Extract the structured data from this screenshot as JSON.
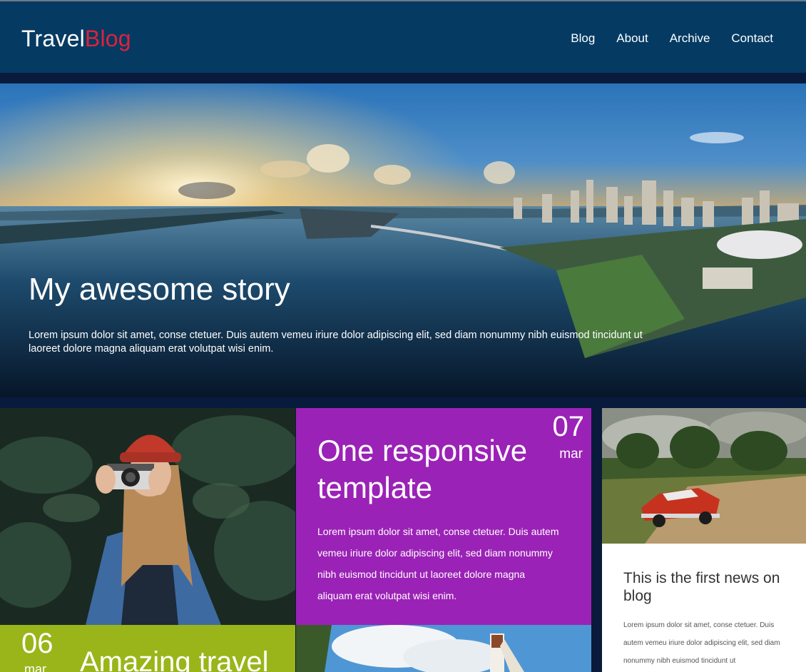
{
  "header": {
    "logo_part1": "Travel",
    "logo_part2": "Blog",
    "nav": [
      "Blog",
      "About",
      "Archive",
      "Contact"
    ]
  },
  "hero": {
    "title": "My awesome story",
    "text": "Lorem ipsum dolor sit amet, conse ctetuer. Duis autem vemeu iriure dolor adipiscing elit, sed diam nonummy nibh euismod tincidunt ut laoreet dolore magna aliquam erat volutpat wisi enim."
  },
  "post_purple": {
    "title": "One responsive template",
    "day": "07",
    "month": "mar",
    "text": "Lorem ipsum dolor sit amet, conse ctetuer. Duis autem vemeu iriure dolor adipiscing elit, sed diam nonummy nibh euismod tincidunt ut laoreet dolore magna aliquam erat volutpat wisi enim."
  },
  "post_news": {
    "title": "This is the first news on blog",
    "text": "Lorem ipsum dolor sit amet, conse ctetuer. Duis autem vemeu iriure dolor adipiscing elit, sed diam nonummy nibh euismod tincidunt ut"
  },
  "post_green": {
    "day": "06",
    "month": "mar",
    "title": "Amazing travel"
  },
  "colors": {
    "header_bg": "#053b63",
    "logo_accent": "#e0213a",
    "purple_tile": "#9b22b6",
    "green_tile": "#9ab51a"
  }
}
